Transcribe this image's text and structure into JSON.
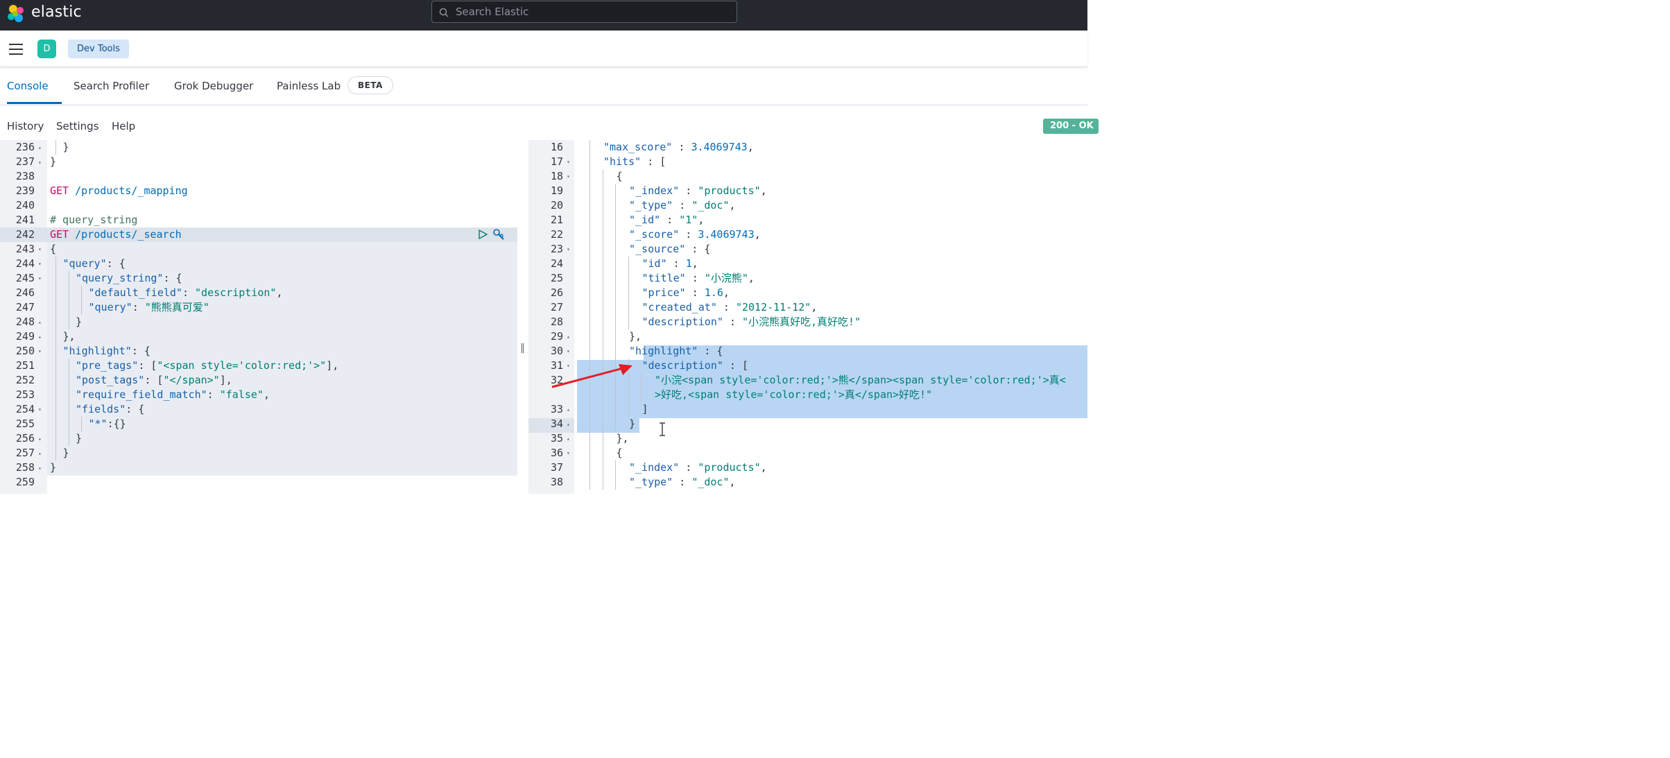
{
  "header": {
    "brand": "elastic",
    "search_placeholder": "Search Elastic"
  },
  "nav": {
    "avatar_letter": "D",
    "breadcrumb": "Dev Tools"
  },
  "tabs": [
    {
      "label": "Console",
      "active": true
    },
    {
      "label": "Search Profiler",
      "active": false
    },
    {
      "label": "Grok Debugger",
      "active": false
    },
    {
      "label": "Painless Lab",
      "active": false
    }
  ],
  "beta_badge": "BETA",
  "actions": [
    "History",
    "Settings",
    "Help"
  ],
  "status_badge": "200 - OK",
  "colors": {
    "accent": "#006bb8",
    "status": "#54b399",
    "method": "#c80a68",
    "string": "#017d73"
  },
  "request_lines": [
    {
      "n": "236",
      "fold": "▴",
      "indent": 1,
      "parts": [
        {
          "t": "}",
          "c": "g"
        }
      ]
    },
    {
      "n": "237",
      "fold": "▴",
      "indent": 0,
      "parts": [
        {
          "t": "}",
          "c": "g"
        }
      ]
    },
    {
      "n": "238",
      "fold": "",
      "indent": 0,
      "parts": []
    },
    {
      "n": "239",
      "fold": "",
      "indent": 0,
      "parts": [
        {
          "t": "GET",
          "c": "m"
        },
        {
          "t": " /products/_mapping",
          "c": "p"
        }
      ]
    },
    {
      "n": "240",
      "fold": "",
      "indent": 0,
      "parts": []
    },
    {
      "n": "241",
      "fold": "",
      "indent": 0,
      "parts": [
        {
          "t": "# query_string",
          "c": "cm"
        }
      ]
    },
    {
      "n": "242",
      "fold": "",
      "indent": 0,
      "parts": [
        {
          "t": "GET",
          "c": "m"
        },
        {
          "t": " /products/_search",
          "c": "p"
        }
      ]
    },
    {
      "n": "243",
      "fold": "▾",
      "indent": 0,
      "parts": [
        {
          "t": "{",
          "c": "g"
        }
      ]
    },
    {
      "n": "244",
      "fold": "▾",
      "indent": 1,
      "parts": [
        {
          "t": "\"query\"",
          "c": "k"
        },
        {
          "t": ": {",
          "c": "g"
        }
      ]
    },
    {
      "n": "245",
      "fold": "▾",
      "indent": 2,
      "parts": [
        {
          "t": "\"query_string\"",
          "c": "k"
        },
        {
          "t": ": {",
          "c": "g"
        }
      ]
    },
    {
      "n": "246",
      "fold": "",
      "indent": 3,
      "parts": [
        {
          "t": "\"default_field\"",
          "c": "k"
        },
        {
          "t": ": ",
          "c": "g"
        },
        {
          "t": "\"description\"",
          "c": "s"
        },
        {
          "t": ",",
          "c": "g"
        }
      ]
    },
    {
      "n": "247",
      "fold": "",
      "indent": 3,
      "parts": [
        {
          "t": "\"query\"",
          "c": "k"
        },
        {
          "t": ": ",
          "c": "g"
        },
        {
          "t": "\"熊熊真可爱\"",
          "c": "s"
        }
      ]
    },
    {
      "n": "248",
      "fold": "▴",
      "indent": 2,
      "parts": [
        {
          "t": "}",
          "c": "g"
        }
      ]
    },
    {
      "n": "249",
      "fold": "▴",
      "indent": 1,
      "parts": [
        {
          "t": "},",
          "c": "g"
        }
      ]
    },
    {
      "n": "250",
      "fold": "▾",
      "indent": 1,
      "parts": [
        {
          "t": "\"highlight\"",
          "c": "k"
        },
        {
          "t": ": {",
          "c": "g"
        }
      ]
    },
    {
      "n": "251",
      "fold": "",
      "indent": 2,
      "parts": [
        {
          "t": "\"pre_tags\"",
          "c": "k"
        },
        {
          "t": ": [",
          "c": "g"
        },
        {
          "t": "\"<span style='color:red;'>\"",
          "c": "s"
        },
        {
          "t": "],",
          "c": "g"
        }
      ]
    },
    {
      "n": "252",
      "fold": "",
      "indent": 2,
      "parts": [
        {
          "t": "\"post_tags\"",
          "c": "k"
        },
        {
          "t": ": [",
          "c": "g"
        },
        {
          "t": "\"</span>\"",
          "c": "s"
        },
        {
          "t": "],",
          "c": "g"
        }
      ]
    },
    {
      "n": "253",
      "fold": "",
      "indent": 2,
      "parts": [
        {
          "t": "\"require_field_match\"",
          "c": "k"
        },
        {
          "t": ": ",
          "c": "g"
        },
        {
          "t": "\"false\"",
          "c": "s"
        },
        {
          "t": ",",
          "c": "g"
        }
      ]
    },
    {
      "n": "254",
      "fold": "▾",
      "indent": 2,
      "parts": [
        {
          "t": "\"fields\"",
          "c": "k"
        },
        {
          "t": ": {",
          "c": "g"
        }
      ]
    },
    {
      "n": "255",
      "fold": "",
      "indent": 3,
      "parts": [
        {
          "t": "\"*\"",
          "c": "k"
        },
        {
          "t": ":{}",
          "c": "g"
        }
      ]
    },
    {
      "n": "256",
      "fold": "▴",
      "indent": 2,
      "parts": [
        {
          "t": "}",
          "c": "g"
        }
      ]
    },
    {
      "n": "257",
      "fold": "▴",
      "indent": 1,
      "parts": [
        {
          "t": "}",
          "c": "g"
        }
      ]
    },
    {
      "n": "258",
      "fold": "▴",
      "indent": 0,
      "parts": [
        {
          "t": "}",
          "c": "g"
        }
      ]
    },
    {
      "n": "259",
      "fold": "",
      "indent": 0,
      "parts": []
    }
  ],
  "response_lines": [
    {
      "n": "16",
      "fold": "",
      "indent": 1,
      "parts": [
        {
          "t": "\"max_score\"",
          "c": "k"
        },
        {
          "t": " : ",
          "c": "g"
        },
        {
          "t": "3.4069743",
          "c": "p"
        },
        {
          "t": ",",
          "c": "g"
        }
      ]
    },
    {
      "n": "17",
      "fold": "▾",
      "indent": 1,
      "parts": [
        {
          "t": "\"hits\"",
          "c": "k"
        },
        {
          "t": " : [",
          "c": "g"
        }
      ]
    },
    {
      "n": "18",
      "fold": "▾",
      "indent": 2,
      "parts": [
        {
          "t": "{",
          "c": "g"
        }
      ]
    },
    {
      "n": "19",
      "fold": "",
      "indent": 3,
      "parts": [
        {
          "t": "\"_index\"",
          "c": "k"
        },
        {
          "t": " : ",
          "c": "g"
        },
        {
          "t": "\"products\"",
          "c": "s"
        },
        {
          "t": ",",
          "c": "g"
        }
      ]
    },
    {
      "n": "20",
      "fold": "",
      "indent": 3,
      "parts": [
        {
          "t": "\"_type\"",
          "c": "k"
        },
        {
          "t": " : ",
          "c": "g"
        },
        {
          "t": "\"_doc\"",
          "c": "s"
        },
        {
          "t": ",",
          "c": "g"
        }
      ]
    },
    {
      "n": "21",
      "fold": "",
      "indent": 3,
      "parts": [
        {
          "t": "\"_id\"",
          "c": "k"
        },
        {
          "t": " : ",
          "c": "g"
        },
        {
          "t": "\"1\"",
          "c": "s"
        },
        {
          "t": ",",
          "c": "g"
        }
      ]
    },
    {
      "n": "22",
      "fold": "",
      "indent": 3,
      "parts": [
        {
          "t": "\"_score\"",
          "c": "k"
        },
        {
          "t": " : ",
          "c": "g"
        },
        {
          "t": "3.4069743",
          "c": "p"
        },
        {
          "t": ",",
          "c": "g"
        }
      ]
    },
    {
      "n": "23",
      "fold": "▾",
      "indent": 3,
      "parts": [
        {
          "t": "\"_source\"",
          "c": "k"
        },
        {
          "t": " : {",
          "c": "g"
        }
      ]
    },
    {
      "n": "24",
      "fold": "",
      "indent": 4,
      "parts": [
        {
          "t": "\"id\"",
          "c": "k"
        },
        {
          "t": " : ",
          "c": "g"
        },
        {
          "t": "1",
          "c": "p"
        },
        {
          "t": ",",
          "c": "g"
        }
      ]
    },
    {
      "n": "25",
      "fold": "",
      "indent": 4,
      "parts": [
        {
          "t": "\"title\"",
          "c": "k"
        },
        {
          "t": " : ",
          "c": "g"
        },
        {
          "t": "\"小浣熊\"",
          "c": "s"
        },
        {
          "t": ",",
          "c": "g"
        }
      ]
    },
    {
      "n": "26",
      "fold": "",
      "indent": 4,
      "parts": [
        {
          "t": "\"price\"",
          "c": "k"
        },
        {
          "t": " : ",
          "c": "g"
        },
        {
          "t": "1.6",
          "c": "p"
        },
        {
          "t": ",",
          "c": "g"
        }
      ]
    },
    {
      "n": "27",
      "fold": "",
      "indent": 4,
      "parts": [
        {
          "t": "\"created_at\"",
          "c": "k"
        },
        {
          "t": " : ",
          "c": "g"
        },
        {
          "t": "\"2012-11-12\"",
          "c": "s"
        },
        {
          "t": ",",
          "c": "g"
        }
      ]
    },
    {
      "n": "28",
      "fold": "",
      "indent": 4,
      "parts": [
        {
          "t": "\"description\"",
          "c": "k"
        },
        {
          "t": " : ",
          "c": "g"
        },
        {
          "t": "\"小浣熊真好吃,真好吃!\"",
          "c": "s"
        }
      ]
    },
    {
      "n": "29",
      "fold": "▴",
      "indent": 3,
      "parts": [
        {
          "t": "},",
          "c": "g"
        }
      ]
    },
    {
      "n": "30",
      "fold": "▾",
      "indent": 3,
      "parts": [
        {
          "t": "\"highlight\"",
          "c": "k"
        },
        {
          "t": " : {",
          "c": "g"
        }
      ]
    },
    {
      "n": "31",
      "fold": "▾",
      "indent": 4,
      "parts": [
        {
          "t": "\"description\"",
          "c": "k"
        },
        {
          "t": " : [",
          "c": "g"
        }
      ]
    },
    {
      "n": "32",
      "fold": "",
      "indent": 5,
      "parts": [
        {
          "t": "\"小浣<span style='color:red;'>熊</span><span style='color:red;'>真<",
          "c": "s"
        }
      ]
    },
    {
      "n": "",
      "fold": "",
      "indent": 5,
      "parts": [
        {
          "t": ">好吃,<span style='color:red;'>真</span>好吃!\"",
          "c": "s"
        }
      ]
    },
    {
      "n": "33",
      "fold": "▴",
      "indent": 4,
      "parts": [
        {
          "t": "]",
          "c": "g"
        }
      ]
    },
    {
      "n": "34",
      "fold": "▴",
      "indent": 3,
      "parts": [
        {
          "t": "}",
          "c": "g"
        }
      ]
    },
    {
      "n": "35",
      "fold": "▴",
      "indent": 2,
      "parts": [
        {
          "t": "},",
          "c": "g"
        }
      ]
    },
    {
      "n": "36",
      "fold": "▾",
      "indent": 2,
      "parts": [
        {
          "t": "{",
          "c": "g"
        }
      ]
    },
    {
      "n": "37",
      "fold": "",
      "indent": 3,
      "parts": [
        {
          "t": "\"_index\"",
          "c": "k"
        },
        {
          "t": " : ",
          "c": "g"
        },
        {
          "t": "\"products\"",
          "c": "s"
        },
        {
          "t": ",",
          "c": "g"
        }
      ]
    },
    {
      "n": "38",
      "fold": "",
      "indent": 3,
      "parts": [
        {
          "t": "\"_type\"",
          "c": "k"
        },
        {
          "t": " : ",
          "c": "g"
        },
        {
          "t": "\"_doc\"",
          "c": "s"
        },
        {
          "t": ",",
          "c": "g"
        }
      ]
    }
  ]
}
